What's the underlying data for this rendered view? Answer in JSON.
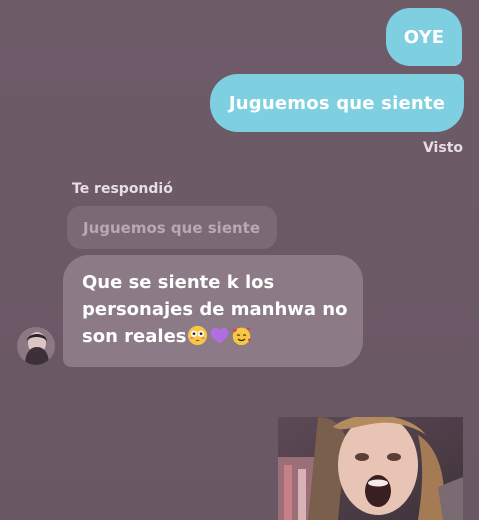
{
  "conversation": {
    "sent_messages": [
      {
        "text": "OYE"
      },
      {
        "text": "Juguemos que siente"
      }
    ],
    "seen_label": "Visto",
    "reply": {
      "label": "Te respondió",
      "quoted_text": "Juguemos que siente",
      "lines": [
        "Que se siente k los",
        "personajes de manhwa no",
        "son reales"
      ],
      "emojis": [
        "flushed-face",
        "purple-heart",
        "smiling-face-with-hearts"
      ]
    }
  },
  "colors": {
    "background": "#6d5a67",
    "sent_bubble": "#7ecfe0",
    "received_bubble": "#8c7a86"
  }
}
